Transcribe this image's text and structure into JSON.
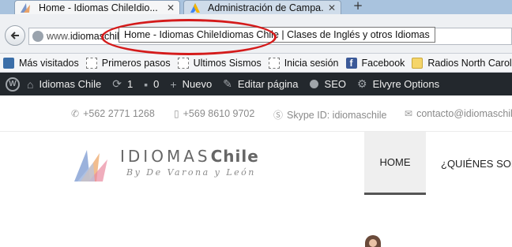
{
  "browser": {
    "tabs": [
      {
        "label": "Home - Idiomas ChileIdio...",
        "close": "✕"
      },
      {
        "label": "Administración de Campa...",
        "close": "✕"
      }
    ],
    "new_tab": "+",
    "url": {
      "prefix": "www.",
      "domain": "idiomaschil"
    },
    "tooltip": "Home - Idiomas ChileIdiomas Chile | Clases de Inglés y otros Idiomas"
  },
  "bookmarks": [
    {
      "label": "Más visitados",
      "icon": "star-icon"
    },
    {
      "label": "Primeros pasos",
      "icon": "page-icon"
    },
    {
      "label": "Ultimos Sismos",
      "icon": "page-icon"
    },
    {
      "label": "Inicia sesión",
      "icon": "page-icon"
    },
    {
      "label": "Facebook",
      "icon": "facebook-icon"
    },
    {
      "label": "Radios North Carolina",
      "icon": "folder-icon"
    }
  ],
  "wp_admin": {
    "site_name": "Idiomas Chile",
    "updates": "1",
    "comments": "0",
    "new": "Nuevo",
    "edit": "Editar página",
    "seo": "SEO",
    "options": "Elvyre Options"
  },
  "contact": {
    "phone": "+562 2771 1268",
    "mobile": "+569 8610 9702",
    "skype": "Skype ID: idiomaschile",
    "email": "contacto@idiomaschil"
  },
  "logo": {
    "title_a": "IDIOMAS",
    "title_b": "Chile",
    "subtitle": "By De Varona y León"
  },
  "menu": {
    "home": "HOME",
    "quienes": "¿QUIÉNES SOM"
  },
  "colors": {
    "admin_bar": "#23282d",
    "annotation": "#d41b1b",
    "tab_strip": "#a9c3de"
  }
}
